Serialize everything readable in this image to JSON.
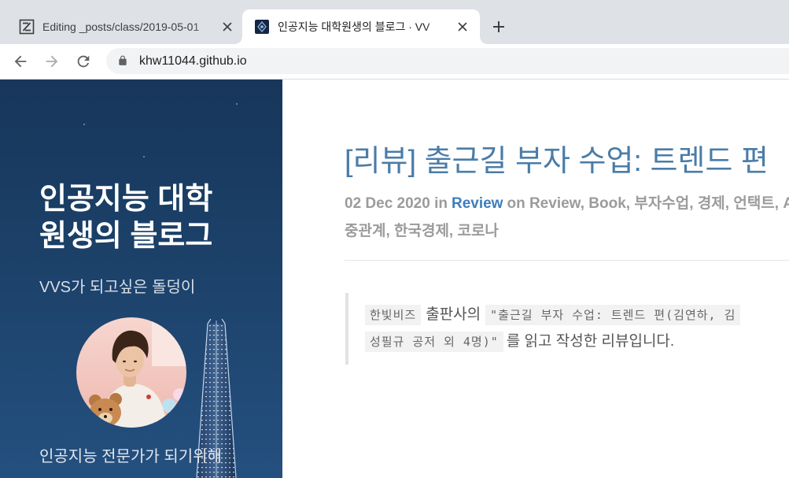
{
  "browser": {
    "tabs": [
      {
        "title": "Editing _posts/class/2019-05-01",
        "icon": "forestry-icon",
        "close_icon": "close-icon",
        "active": false
      },
      {
        "title": "인공지능 대학원생의 블로그 · VV",
        "icon": "site-favicon-icon",
        "close_icon": "close-icon",
        "active": true
      }
    ],
    "new_tab_icon": "plus-icon",
    "toolbar": {
      "back_icon": "arrow-back-icon",
      "forward_icon": "arrow-forward-icon",
      "reload_icon": "reload-icon",
      "lock_icon": "lock-icon",
      "url": "khw11044.github.io"
    }
  },
  "sidebar": {
    "title_lines": [
      "인공지능 대학",
      "원생의 블로그"
    ],
    "tagline": "VVS가 되고싶은 돌덩이",
    "bio": "인공지능 전문가가 되기위해"
  },
  "post": {
    "title": "[리뷰] 출근길 부자 수업: 트렌드 편",
    "meta": {
      "date_prefix": "02 Dec 2020 in",
      "category": "Review",
      "tags_line1": "on Review, Book, 부자수업, 경제, 언택트, A",
      "tags_line2": "중관계, 한국경제, 코로나"
    },
    "intro": {
      "publisher_code": "한빛비즈",
      "publisher_suffix": "출판사의",
      "book_code_line1": "\"출근길 부자 수업: 트렌드 편(김연하, 김",
      "book_code_line2": "성필규 공저 외 4명)\"",
      "closing": "를 읽고 작성한 리뷰입니다."
    }
  },
  "colors": {
    "tabstrip": "#dee1e6",
    "sidebar_top": "#17365a",
    "sidebar_bottom": "#24507f",
    "title_blue": "#4a7ca8",
    "link_blue": "#3d7dbd",
    "meta_gray": "#9b9b9b",
    "body_text": "#555555",
    "code_bg": "#f2f2f2"
  }
}
